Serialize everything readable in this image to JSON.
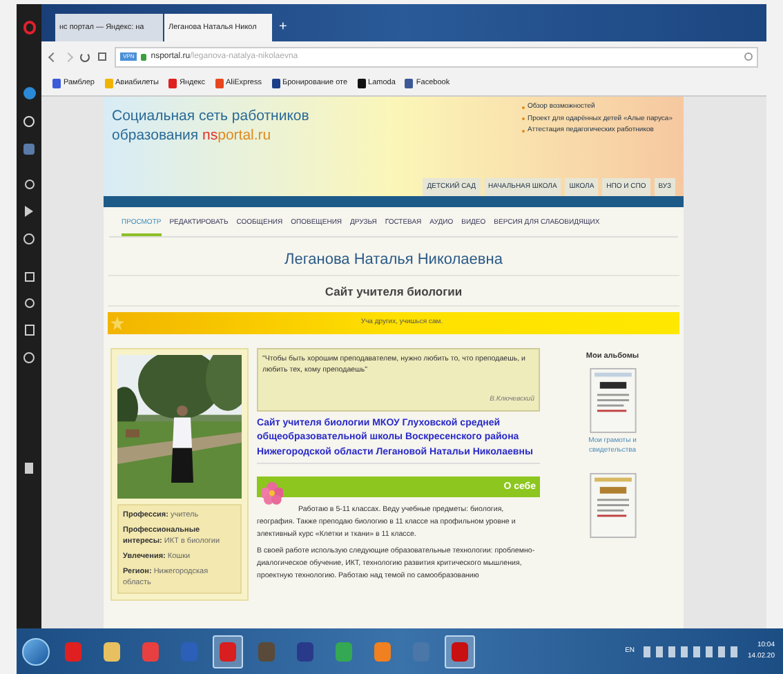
{
  "browser": {
    "tabs": [
      {
        "title": "нс портал — Яндекс: на",
        "selected": false
      },
      {
        "title": "Леганова Наталья Никол",
        "selected": true
      }
    ],
    "new_tab": "+",
    "address": {
      "badge": "VPN",
      "domain": "nsportal.ru",
      "path": "/leganova-natalya-nikolaevna"
    },
    "bookmarks": [
      {
        "label": "Рамблер",
        "color": "#3b5bdb"
      },
      {
        "label": "Авиабилеты",
        "color": "#f0b400"
      },
      {
        "label": "Яндекс",
        "color": "#e02020"
      },
      {
        "label": "AliExpress",
        "color": "#e8461e"
      },
      {
        "label": "Бронирование оте",
        "color": "#1d3f8a"
      },
      {
        "label": "Lamoda",
        "color": "#111111"
      },
      {
        "label": "Facebook",
        "color": "#3b5998"
      }
    ]
  },
  "site": {
    "title_line1": "Социальная сеть работников",
    "title_line2": "образования ",
    "brand_accent": "ns",
    "brand_rest": "portal.ru",
    "header_links": [
      "Обзор возможностей",
      "Проект для одарённых детей «Алые паруса»",
      "Аттестация педагогических работников"
    ],
    "sections": [
      "ДЕТСКИЙ САД",
      "НАЧАЛЬНАЯ ШКОЛА",
      "ШКОЛА",
      "НПО И СПО",
      "ВУЗ"
    ]
  },
  "nav": [
    {
      "label": "ПРОСМОТР",
      "selected": true
    },
    {
      "label": "РЕДАКТИРОВАТЬ",
      "selected": false
    },
    {
      "label": "СООБЩЕНИЯ",
      "selected": false
    },
    {
      "label": "ОПОВЕЩЕНИЯ",
      "selected": false
    },
    {
      "label": "ДРУЗЬЯ",
      "selected": false
    },
    {
      "label": "ГОСТЕВАЯ",
      "selected": false
    },
    {
      "label": "АУДИО",
      "selected": false
    },
    {
      "label": "ВИДЕО",
      "selected": false
    },
    {
      "label": "ВЕРСИЯ ДЛЯ СЛАБОВИДЯЩИХ",
      "selected": false
    }
  ],
  "profile": {
    "name": "Леганова Наталья Николаевна",
    "site_title": "Сайт учителя биологии",
    "motto": "Уча других, учишься сам."
  },
  "info": [
    {
      "label": "Профессия:",
      "value": "учитель"
    },
    {
      "label": "Профессиональные интересы:",
      "value": "ИКТ в биологии"
    },
    {
      "label": "Увлечения:",
      "value": "Кошки"
    },
    {
      "label": "Регион:",
      "value": "Нижегородская область"
    }
  ],
  "quote": {
    "text": "\"Чтобы быть хорошим преподавателем, нужно любить то, что преподаешь, и любить тех, кому преподаешь\"",
    "author": "В.Ключевский"
  },
  "heading": "Сайт учителя биологии МКОУ Глуховской средней общеобразовательной школы Воскресенского района Нижегородской области Легановой Натальи Николаевны",
  "about": {
    "title": "О себе",
    "paragraphs": [
      "Работаю в 5-11 классах. Веду учебные предметы: биология, география. Также преподаю биологию в  11 классе на профильном уровне и элективный курс «Клетки и ткани» в 11 классе.",
      "В своей работе использую следующие образовательные технологии: проблемно-диалогическое обучение, ИКТ, технологию развития критического мышления, проектную технологию. Работаю над темой по самообразованию"
    ]
  },
  "albums": {
    "title": "Мои альбомы",
    "caption": "Мои грамоты и свидетельства"
  },
  "taskbar": {
    "apps": [
      {
        "color": "#e02020",
        "selected": false
      },
      {
        "color": "#e8c060",
        "selected": false
      },
      {
        "color": "#e84040",
        "selected": false
      },
      {
        "color": "#2b5fb8",
        "selected": false
      },
      {
        "color": "#d81e1e",
        "selected": true
      },
      {
        "color": "#5a4a3a",
        "selected": false
      },
      {
        "color": "#2a3a8a",
        "selected": false
      },
      {
        "color": "#34a853",
        "selected": false
      },
      {
        "color": "#f08020",
        "selected": false
      },
      {
        "color": "#4a76a8",
        "selected": false
      },
      {
        "color": "#c81010",
        "selected": true
      }
    ],
    "language": "EN",
    "time": "10:04",
    "date": "14.02.20"
  }
}
